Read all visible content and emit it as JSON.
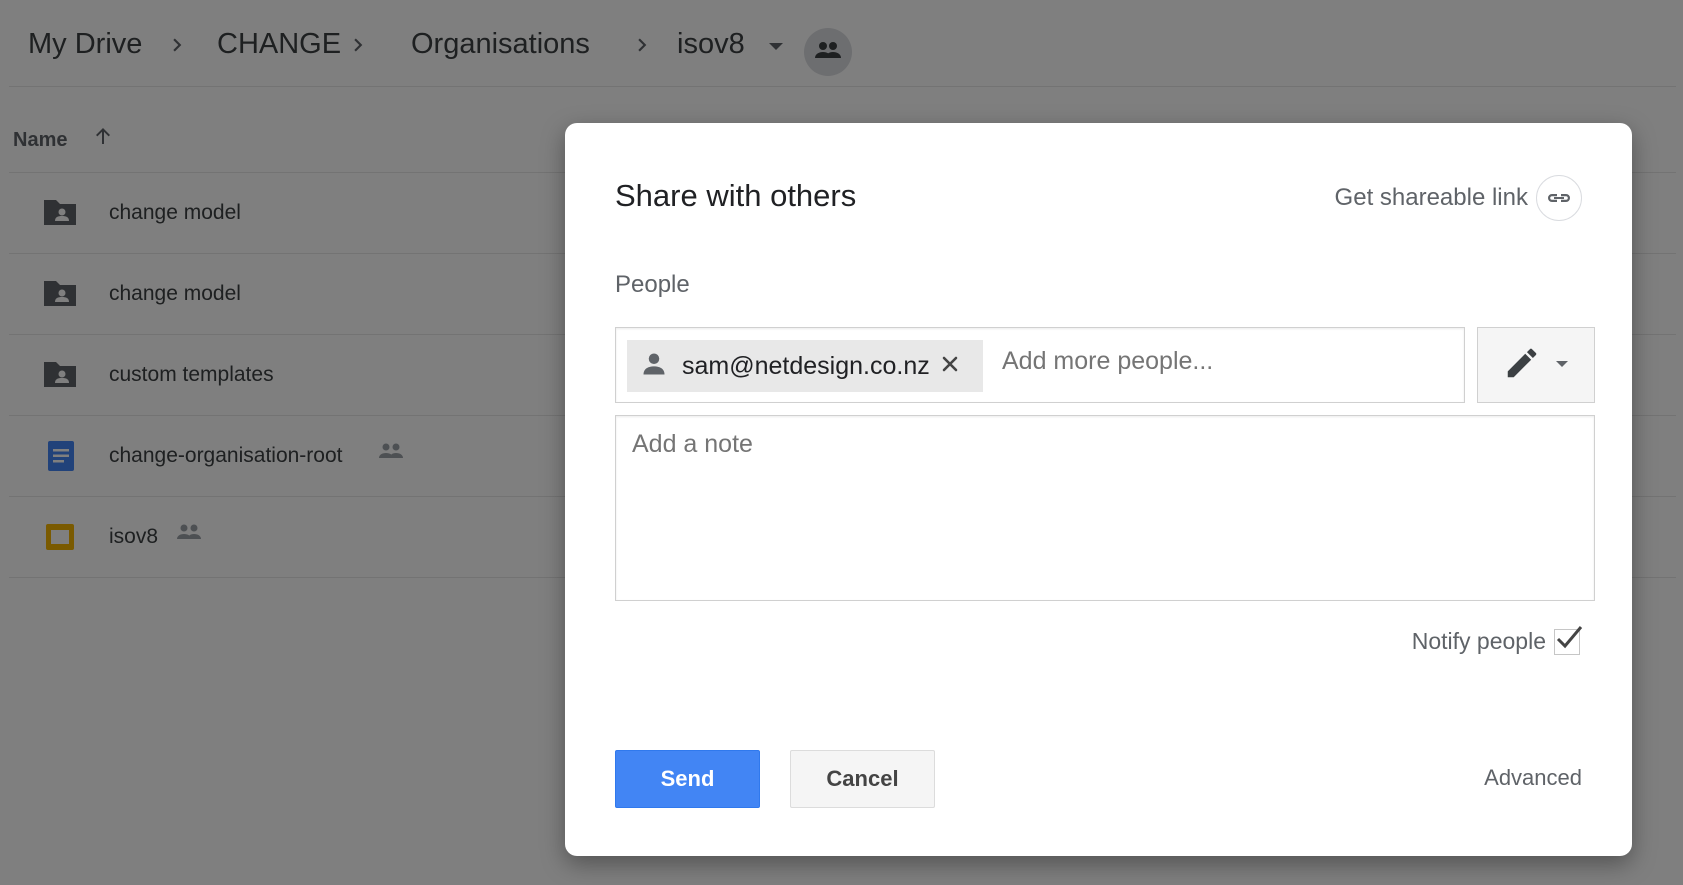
{
  "breadcrumb": {
    "items": [
      "My Drive",
      "CHANGE",
      "Organisations",
      "isov8"
    ]
  },
  "list": {
    "column_name": "Name",
    "rows": [
      {
        "name": "change model",
        "type": "shared-folder"
      },
      {
        "name": "change model",
        "type": "shared-folder"
      },
      {
        "name": "custom templates",
        "type": "shared-folder"
      },
      {
        "name": "change-organisation-root",
        "type": "google-doc",
        "shared": true
      },
      {
        "name": "isov8",
        "type": "google-slides",
        "shared": true
      }
    ]
  },
  "dialog": {
    "title": "Share with others",
    "get_link_label": "Get shareable link",
    "people_label": "People",
    "chip_email": "sam@netdesign.co.nz",
    "add_people_placeholder": "Add more people...",
    "note_placeholder": "Add a note",
    "notify_label": "Notify people",
    "notify_checked": true,
    "send_label": "Send",
    "cancel_label": "Cancel",
    "advanced_label": "Advanced"
  },
  "colors": {
    "primary": "#4285f4",
    "doc_icon": "#4285f4",
    "slides_icon": "#f4b400",
    "folder_icon": "#5f6368"
  }
}
